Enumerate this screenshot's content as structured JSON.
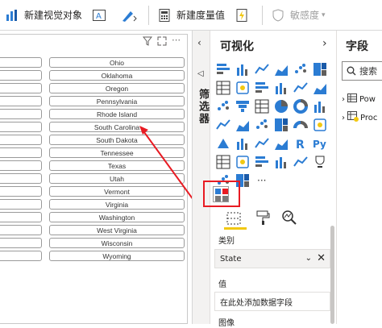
{
  "ribbon": {
    "new_visual": "新建视觉对象",
    "new_measure": "新建度量值",
    "sensitivity": "敏感度"
  },
  "slicer_items": [
    "Ohio",
    "Oklahoma",
    "Oregon",
    "Pennsylvania",
    "Rhode Island",
    "South Carolina",
    "South Dakota",
    "Tennessee",
    "Texas",
    "Utah",
    "Vermont",
    "Virginia",
    "Washington",
    "West Virginia",
    "Wisconsin",
    "Wyoming"
  ],
  "filters_label": "筛选器",
  "viz": {
    "title": "可视化",
    "category_label": "类别",
    "category_value": "State",
    "value_label": "值",
    "value_placeholder": "在此处添加数据字段",
    "image_label": "图像"
  },
  "fields": {
    "title": "字段",
    "search_placeholder": "搜索",
    "table1": "Pow",
    "table2": "Proc"
  },
  "colors": {
    "accent_red": "#e81b23",
    "highlight_yellow": "#f2c811",
    "icon_blue": "#2b7cd3"
  }
}
